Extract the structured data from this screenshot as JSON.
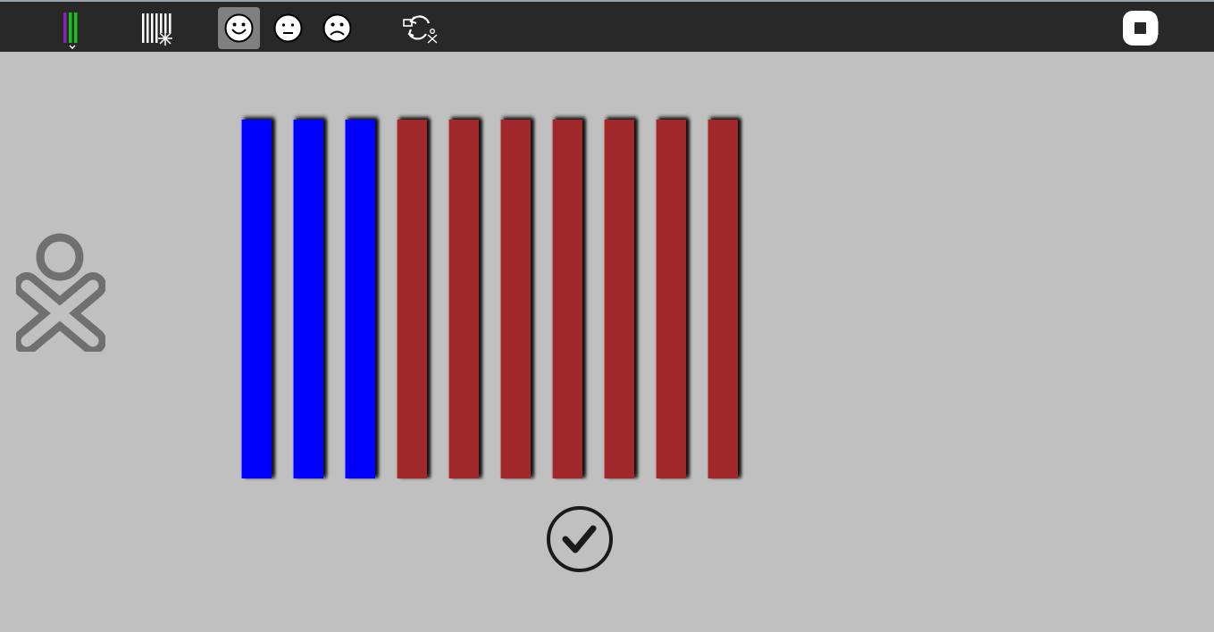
{
  "toolbar": {
    "tools": [
      {
        "name": "bar-colors-palette-icon",
        "active": false
      },
      {
        "name": "random-bars-icon",
        "active": false
      },
      {
        "name": "smiley-happy-icon",
        "active": true
      },
      {
        "name": "smiley-neutral-icon",
        "active": false
      },
      {
        "name": "smiley-sad-icon",
        "active": false
      },
      {
        "name": "share-refresh-icon",
        "active": false
      }
    ],
    "stop_icon": "stop-icon"
  },
  "colors": {
    "toolbar_bg": "#282828",
    "workspace_bg": "#c0c0c0",
    "bar_blue": "#0000ff",
    "bar_red": "#a0282a",
    "icon_white": "#ffffff",
    "xo_gray": "#707070"
  },
  "bars": [
    {
      "color": "blue"
    },
    {
      "color": "blue"
    },
    {
      "color": "blue"
    },
    {
      "color": "red"
    },
    {
      "color": "red"
    },
    {
      "color": "red"
    },
    {
      "color": "red"
    },
    {
      "color": "red"
    },
    {
      "color": "red"
    },
    {
      "color": "red"
    }
  ],
  "xo_icon": "xo-person-icon",
  "check_icon": "checkmark-icon"
}
